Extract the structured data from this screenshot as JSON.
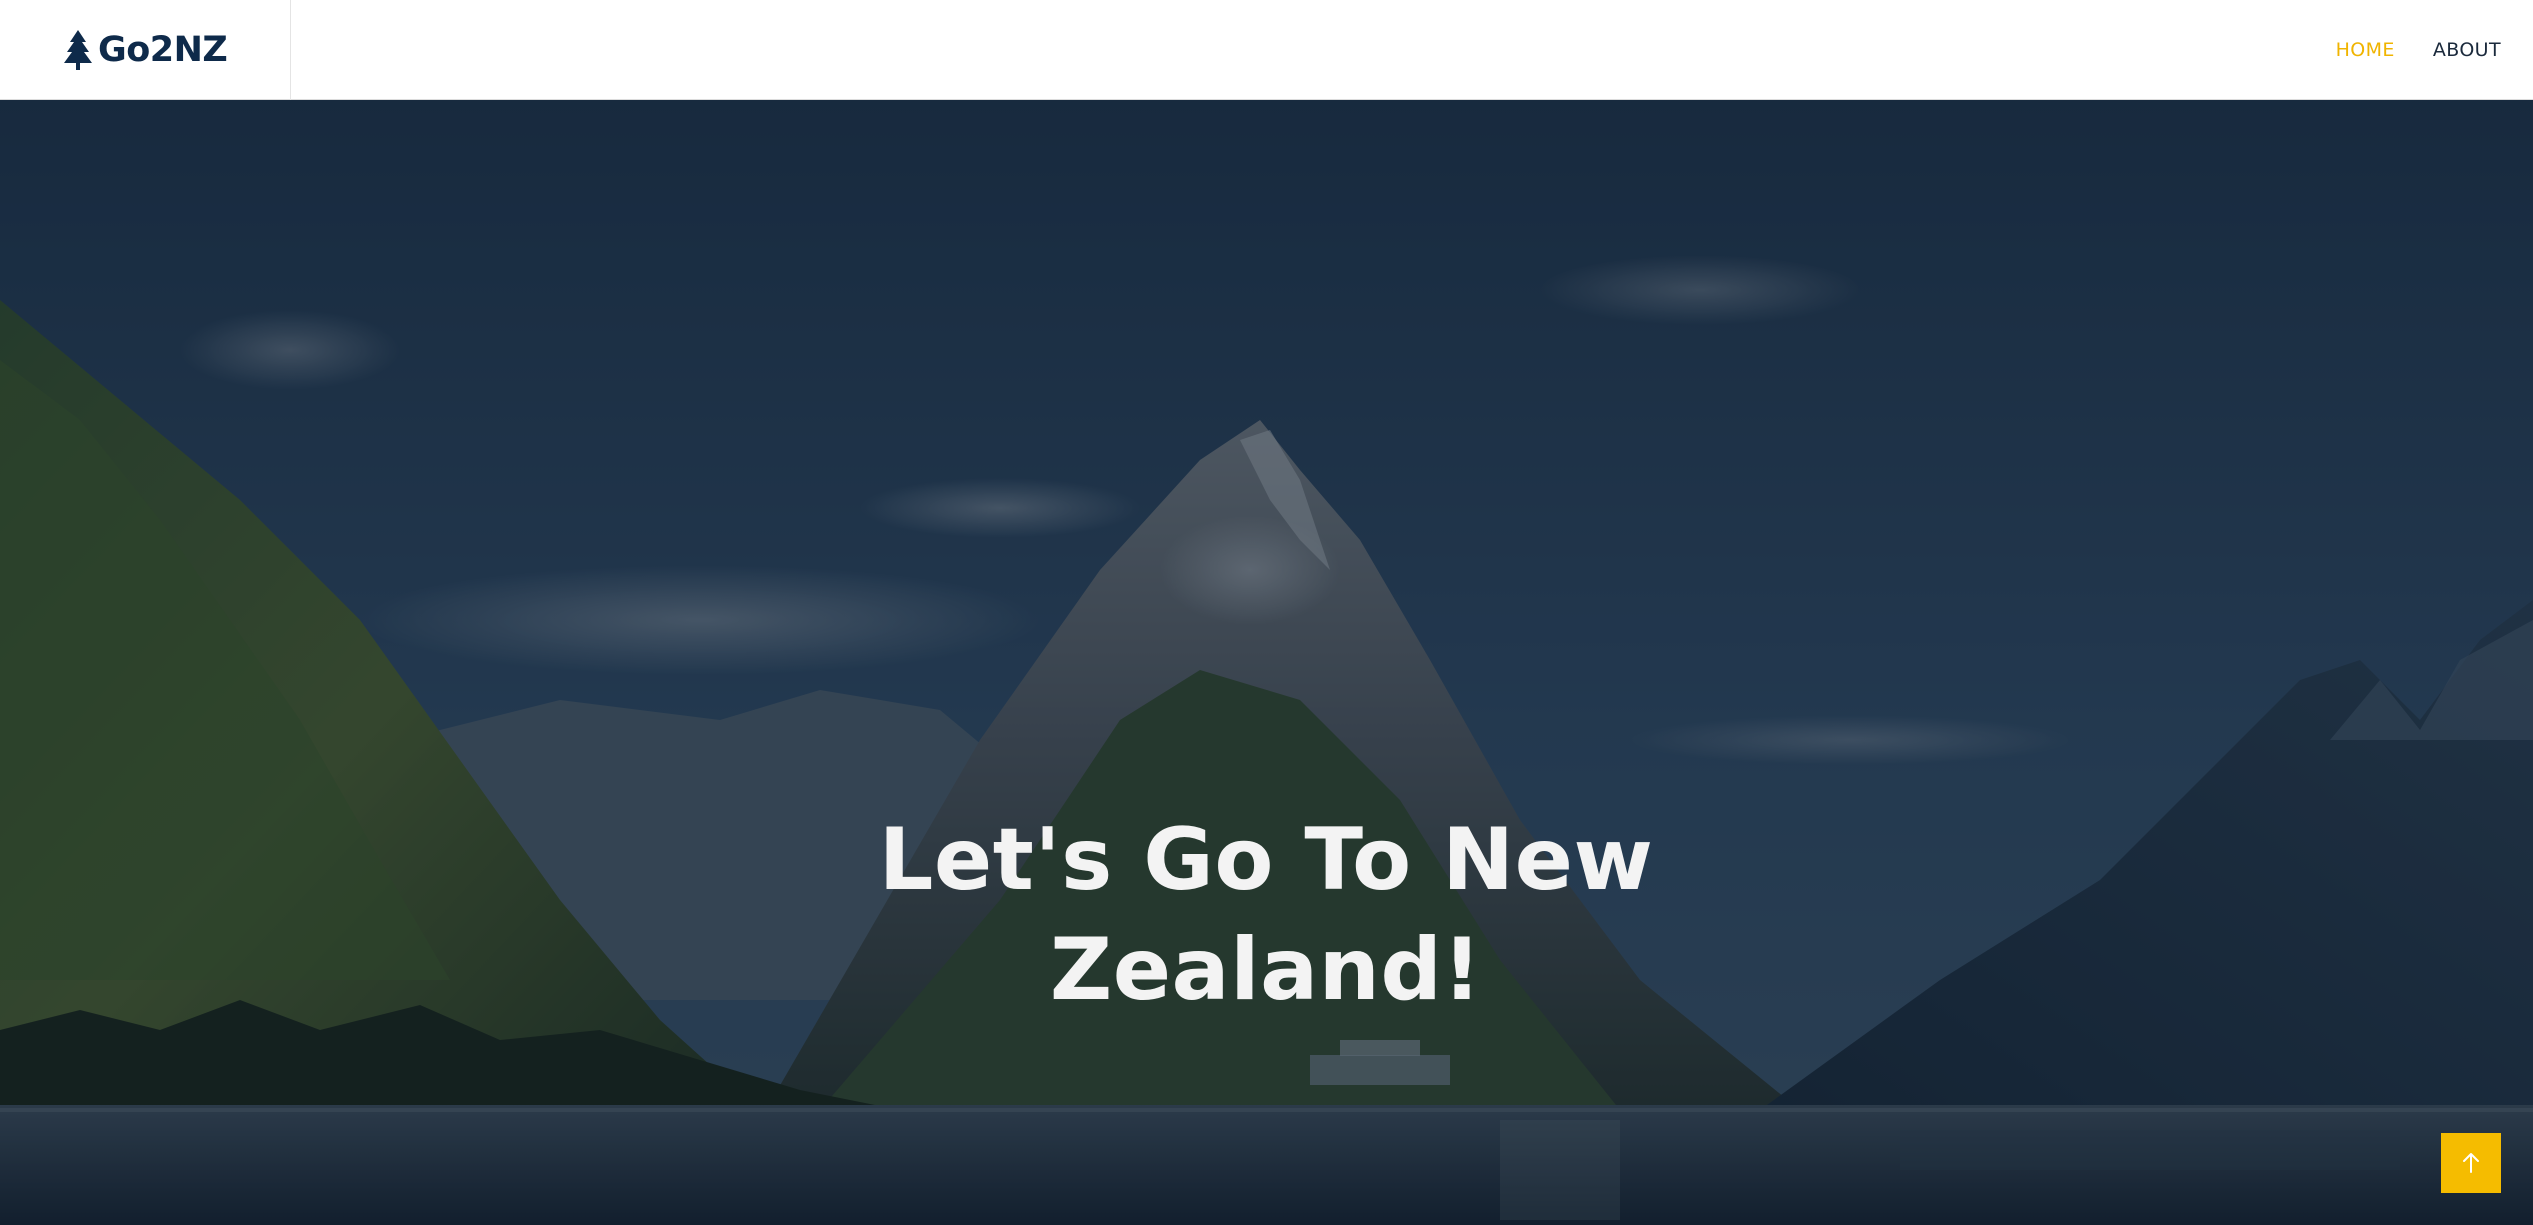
{
  "header": {
    "brand": "Go2NZ",
    "brand_color": "#0e2a4a",
    "brand_icon": "tree-icon",
    "nav": [
      {
        "label": "HOME",
        "active": true,
        "color": "#f0b400"
      },
      {
        "label": "ABOUT",
        "active": false,
        "color": "#1b2a3c"
      }
    ]
  },
  "hero": {
    "title": "Let's Go To New Zealand!",
    "overlay_color": "#0b1a2c"
  },
  "back_to_top": {
    "icon": "arrow-up-icon",
    "color": "#f5bc00"
  }
}
